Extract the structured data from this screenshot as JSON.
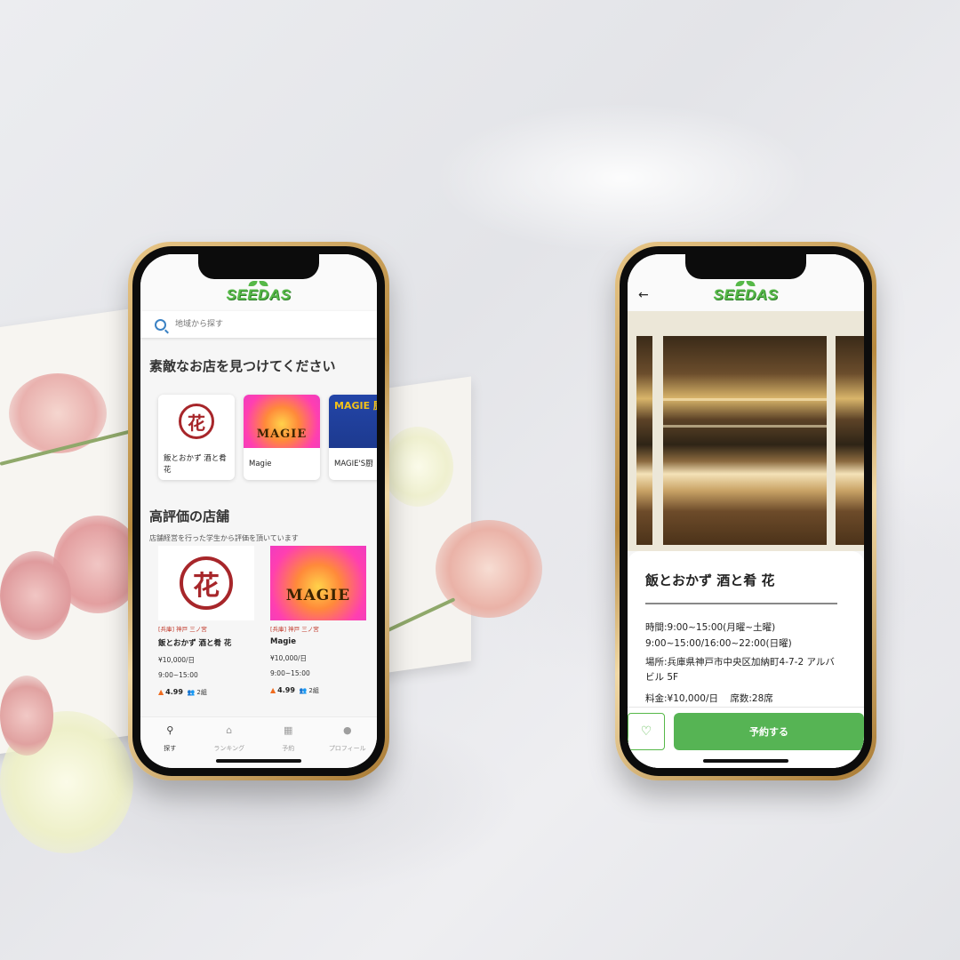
{
  "app": {
    "logo": "SEEDAS"
  },
  "left_screen": {
    "search": {
      "placeholder": "地域から探す"
    },
    "section1": {
      "title": "素敵なお店を見つけてください",
      "cards": [
        {
          "name": "飯とおかず 酒と肴 花",
          "thumb_text": "花"
        },
        {
          "name": "Magie",
          "thumb_text": "MAGIE"
        },
        {
          "name": "MAGIE'S厨",
          "thumb_text": "MAGIE 厨"
        }
      ]
    },
    "section2": {
      "title": "高評価の店舗",
      "subtitle": "店舗経営を行った学生から評価を頂いています",
      "items": [
        {
          "tag": "[兵庫] 神戸 三ノ宮",
          "name": "飯とおかず 酒と肴 花",
          "price": "¥10,000/日",
          "time": "9:00~15:00",
          "rating": "4.99",
          "groups": "2組",
          "thumb_text": "花"
        },
        {
          "tag": "[兵庫] 神戸 三ノ宮",
          "name": "Magie",
          "price": "¥10,000/日",
          "time": "9:00~15:00",
          "rating": "4.99",
          "groups": "2組",
          "thumb_text": "MAGIE"
        }
      ]
    },
    "tabs": [
      {
        "label": "探す",
        "icon": "search-icon"
      },
      {
        "label": "ランキング",
        "icon": "home-icon"
      },
      {
        "label": "予約",
        "icon": "calendar-icon"
      },
      {
        "label": "プロフィール",
        "icon": "profile-icon"
      }
    ]
  },
  "right_screen": {
    "title": "飯とおかず 酒と肴 花",
    "hours1": "時間:9:00~15:00(月曜~土曜)",
    "hours2": "9:00~15:00/16:00~22:00(日曜)",
    "address": "場所:兵庫県神戸市中央区加納町4-7-2 アルバビル 5F",
    "fee": "料金:¥10,000/日",
    "seats": "席数:28席",
    "reserve_label": "予約する"
  },
  "colors": {
    "brand_green": "#56b848",
    "tag_red": "#c0392b"
  }
}
